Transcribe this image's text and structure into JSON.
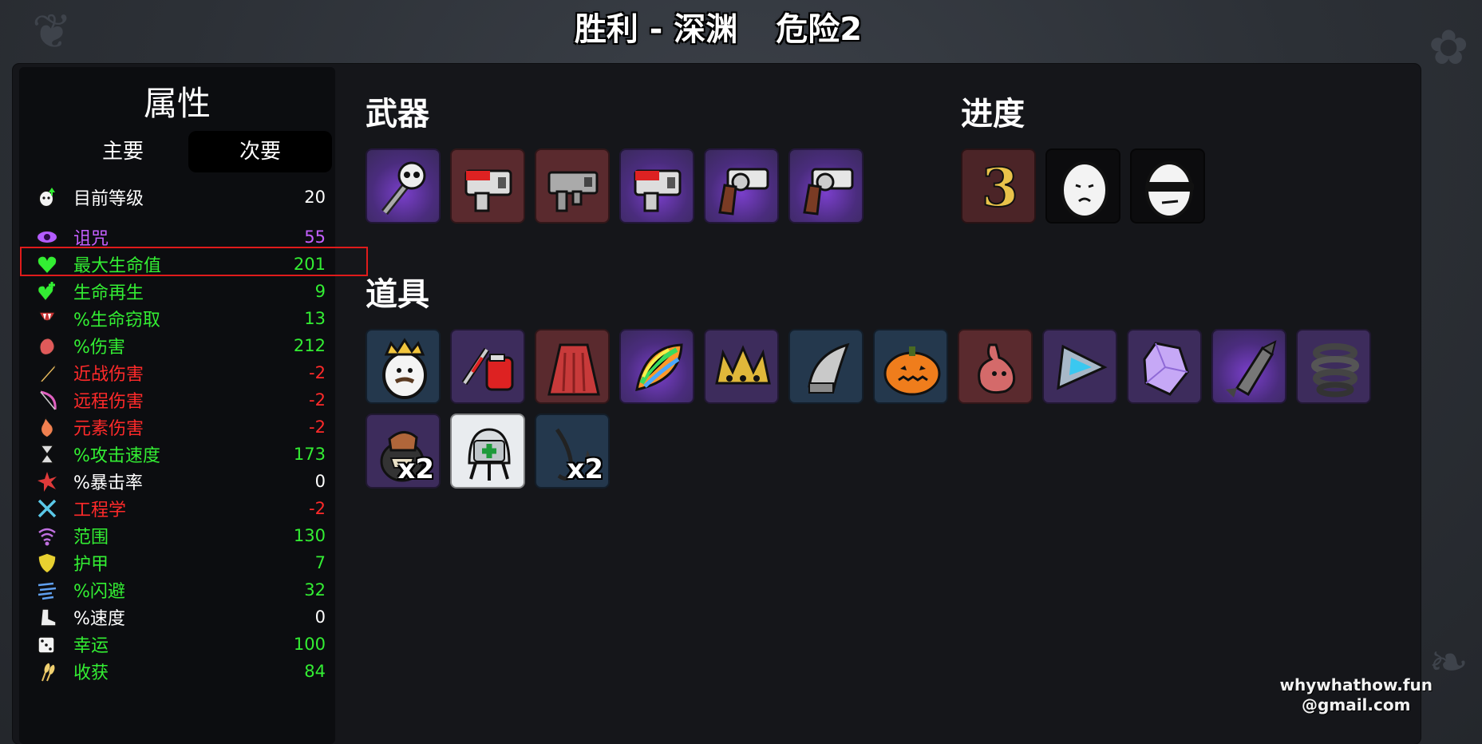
{
  "header": {
    "title": "胜利 - 深渊",
    "danger": "危险2"
  },
  "stats_panel": {
    "title": "属性",
    "tabs": [
      {
        "label": "主要",
        "active": false
      },
      {
        "label": "次要",
        "active": true
      }
    ],
    "level": {
      "label": "目前等级",
      "value": "20",
      "icon": "level-icon"
    },
    "rows": [
      {
        "label": "诅咒",
        "value": "55",
        "color": "purple",
        "icon": "curse-eye-icon"
      },
      {
        "label": "最大生命值",
        "value": "201",
        "color": "green",
        "icon": "heart-icon",
        "highlighted": true
      },
      {
        "label": "生命再生",
        "value": "9",
        "color": "green",
        "icon": "regen-heart-icon"
      },
      {
        "label": "%生命窃取",
        "value": "13",
        "color": "green",
        "icon": "lifesteal-fangs-icon"
      },
      {
        "label": "%伤害",
        "value": "212",
        "color": "green",
        "icon": "damage-muscle-icon"
      },
      {
        "label": "近战伤害",
        "value": "-2",
        "color": "red",
        "icon": "melee-sword-icon"
      },
      {
        "label": "远程伤害",
        "value": "-2",
        "color": "red",
        "icon": "ranged-bow-icon"
      },
      {
        "label": "元素伤害",
        "value": "-2",
        "color": "red",
        "icon": "elemental-flame-icon"
      },
      {
        "label": "%攻击速度",
        "value": "173",
        "color": "green",
        "icon": "attack-speed-hourglass-icon"
      },
      {
        "label": "%暴击率",
        "value": "0",
        "color": "white",
        "icon": "crit-chance-icon"
      },
      {
        "label": "工程学",
        "value": "-2",
        "color": "red",
        "icon": "engineering-wrench-icon"
      },
      {
        "label": "范围",
        "value": "130",
        "color": "green",
        "icon": "range-waves-icon"
      },
      {
        "label": "护甲",
        "value": "7",
        "color": "green",
        "icon": "armor-shield-icon"
      },
      {
        "label": "%闪避",
        "value": "32",
        "color": "green",
        "icon": "dodge-wind-icon"
      },
      {
        "label": "%速度",
        "value": "0",
        "color": "white",
        "icon": "speed-boot-icon"
      },
      {
        "label": "幸运",
        "value": "100",
        "color": "green",
        "icon": "luck-dice-icon"
      },
      {
        "label": "收获",
        "value": "84",
        "color": "green",
        "icon": "harvest-wheat-icon"
      }
    ]
  },
  "weapons": {
    "title": "武器",
    "items": [
      {
        "icon": "skull-staff-weapon-icon",
        "tier": "purple"
      },
      {
        "icon": "red-nail-gun-weapon-icon",
        "tier": "red"
      },
      {
        "icon": "gray-smg-weapon-icon",
        "tier": "red"
      },
      {
        "icon": "red-nail-gun-weapon-icon",
        "tier": "purple"
      },
      {
        "icon": "revolver-weapon-icon",
        "tier": "purple"
      },
      {
        "icon": "revolver-weapon-icon",
        "tier": "purple"
      }
    ]
  },
  "progress": {
    "title": "进度",
    "items": [
      {
        "icon": "danger-3-icon",
        "label": "3",
        "tier": "darkred"
      },
      {
        "icon": "potato-face-icon",
        "tier": "dark"
      },
      {
        "icon": "sunglasses-potato-icon",
        "tier": "dark"
      }
    ]
  },
  "items_section": {
    "title": "道具",
    "items": [
      {
        "icon": "king-potato-item-icon",
        "tier": "blue",
        "qty": ""
      },
      {
        "icon": "blood-bag-syringe-item-icon",
        "tier": "purple-flat",
        "qty": ""
      },
      {
        "icon": "red-cape-item-icon",
        "tier": "red",
        "qty": ""
      },
      {
        "icon": "rainbow-leaf-item-icon",
        "tier": "purple",
        "qty": ""
      },
      {
        "icon": "spiked-crown-item-icon",
        "tier": "purple-flat",
        "qty": ""
      },
      {
        "icon": "metal-claw-item-icon",
        "tier": "blue",
        "qty": ""
      },
      {
        "icon": "pumpkin-item-icon",
        "tier": "blue",
        "qty": ""
      },
      {
        "icon": "stomach-item-icon",
        "tier": "red",
        "qty": ""
      },
      {
        "icon": "triangle-prism-item-icon",
        "tier": "purple-flat",
        "qty": ""
      },
      {
        "icon": "crystal-item-icon",
        "tier": "purple-flat",
        "qty": ""
      },
      {
        "icon": "rocket-missile-item-icon",
        "tier": "purple",
        "qty": ""
      },
      {
        "icon": "coil-spring-item-icon",
        "tier": "purple-flat",
        "qty": ""
      },
      {
        "icon": "mutant-pot-item-icon",
        "tier": "purple-flat",
        "qty": "x2"
      },
      {
        "icon": "medic-turret-item-icon",
        "tier": "white",
        "qty": ""
      },
      {
        "icon": "fishing-hook-item-icon",
        "tier": "blue",
        "qty": "x2"
      }
    ]
  },
  "watermark": {
    "line1": "whywhathow.fun",
    "line2": "@gmail.com"
  },
  "colors": {
    "green": "#33ee33",
    "red": "#ff2a2a",
    "purple": "#c560ff",
    "highlight": "#e01b1b"
  }
}
